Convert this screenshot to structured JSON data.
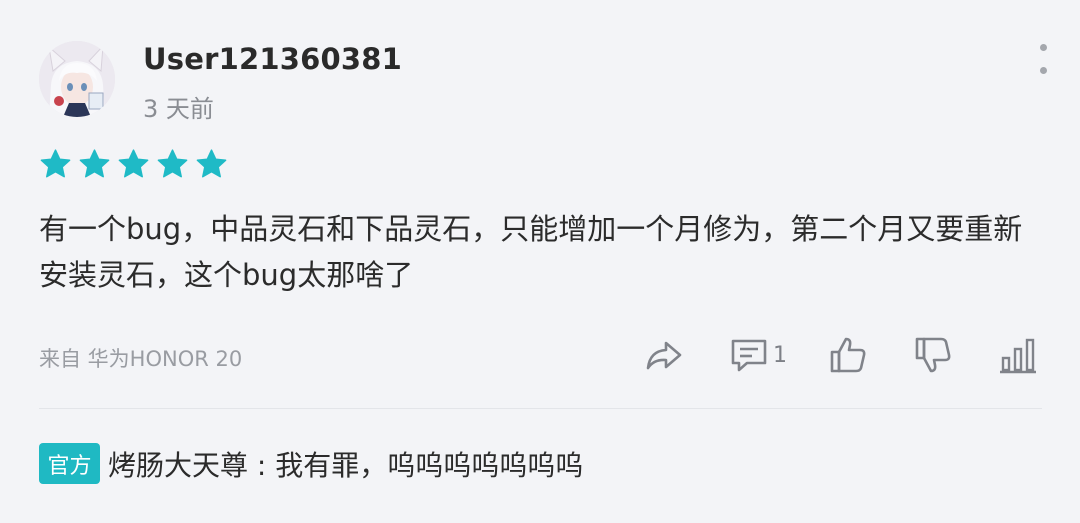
{
  "review": {
    "username": "User121360381",
    "time_ago": "3 天前",
    "rating": 5,
    "star_color": "#1fbac6",
    "text": "有一个bug，中品灵石和下品灵石，只能增加一个月修为，第二个月又要重新安装灵石，这个bug太那啥了",
    "device": "来自 华为HONOR 20",
    "reply_count": "1"
  },
  "icons": {
    "more": "more-vertical-icon",
    "share": "share-icon",
    "comment": "comment-icon",
    "like": "thumbs-up-icon",
    "dislike": "thumbs-down-icon",
    "stats": "bar-chart-icon"
  },
  "official_reply": {
    "badge": "官方",
    "text": "烤肠大天尊 : 我有罪，呜呜呜呜呜呜呜",
    "badge_color": "#1fb9c3"
  }
}
